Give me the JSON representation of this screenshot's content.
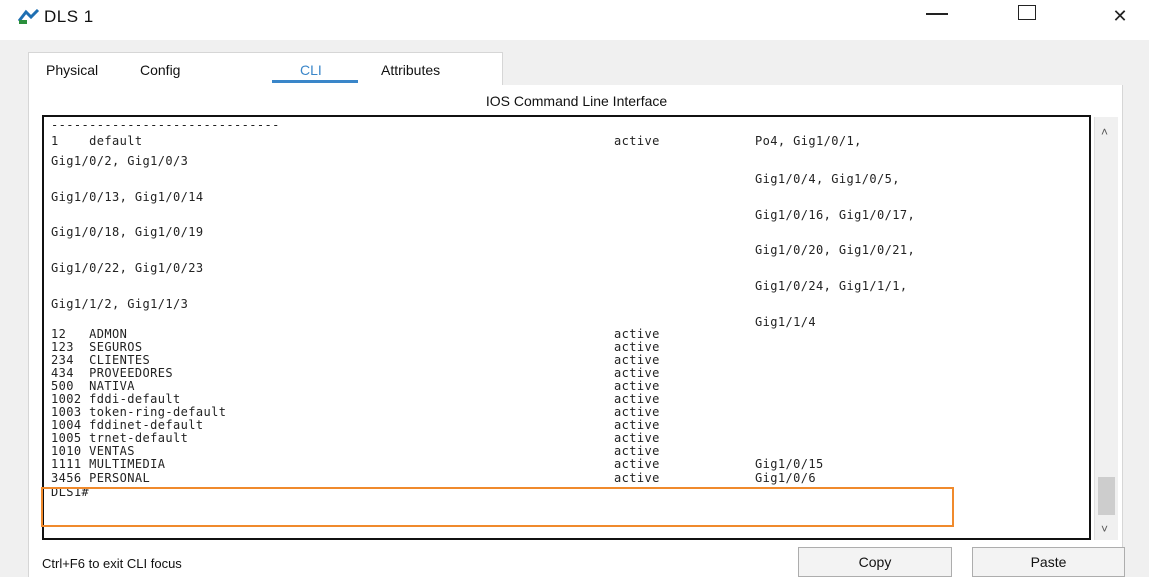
{
  "window": {
    "title": "DLS 1",
    "controls": {
      "minimize": "—",
      "maximize": "☐",
      "close": "✕"
    }
  },
  "tabs": [
    {
      "label": "Physical"
    },
    {
      "label": "Config"
    },
    {
      "label": "CLI",
      "active": true
    },
    {
      "label": "Attributes"
    }
  ],
  "panel": {
    "title": "IOS Command Line Interface"
  },
  "terminal": {
    "separator": "------------------------------",
    "lines": [
      {
        "col1": "1    default",
        "col2": "active",
        "col3": "Po4, Gig1/0/1,"
      },
      {
        "col1": "Gig1/0/2, Gig1/0/3",
        "col2": "",
        "col3": ""
      },
      {
        "col1": "",
        "col2": "",
        "col3": "Gig1/0/4, Gig1/0/5,"
      },
      {
        "col1": "Gig1/0/13, Gig1/0/14",
        "col2": "",
        "col3": ""
      },
      {
        "col1": "",
        "col2": "",
        "col3": "Gig1/0/16, Gig1/0/17,"
      },
      {
        "col1": "Gig1/0/18, Gig1/0/19",
        "col2": "",
        "col3": ""
      },
      {
        "col1": "",
        "col2": "",
        "col3": "Gig1/0/20, Gig1/0/21,"
      },
      {
        "col1": "Gig1/0/22, Gig1/0/23",
        "col2": "",
        "col3": ""
      },
      {
        "col1": "",
        "col2": "",
        "col3": "Gig1/0/24, Gig1/1/1,"
      },
      {
        "col1": "Gig1/1/2, Gig1/1/3",
        "col2": "",
        "col3": ""
      },
      {
        "col1": "",
        "col2": "",
        "col3": "Gig1/1/4"
      }
    ],
    "vlans": [
      {
        "col1": "12   ADMON",
        "col2": "active",
        "col3": ""
      },
      {
        "col1": "123  SEGUROS",
        "col2": "active",
        "col3": ""
      },
      {
        "col1": "234  CLIENTES",
        "col2": "active",
        "col3": ""
      },
      {
        "col1": "434  PROVEEDORES",
        "col2": "active",
        "col3": ""
      },
      {
        "col1": "500  NATIVA",
        "col2": "active",
        "col3": ""
      },
      {
        "col1": "1002 fddi-default",
        "col2": "active",
        "col3": ""
      },
      {
        "col1": "1003 token-ring-default",
        "col2": "active",
        "col3": ""
      },
      {
        "col1": "1004 fddinet-default",
        "col2": "active",
        "col3": ""
      },
      {
        "col1": "1005 trnet-default",
        "col2": "active",
        "col3": ""
      },
      {
        "col1": "1010 VENTAS",
        "col2": "active",
        "col3": ""
      },
      {
        "col1": "1111 MULTIMEDIA",
        "col2": "active",
        "col3": "Gig1/0/15"
      },
      {
        "col1": "3456 PERSONAL",
        "col2": "active",
        "col3": "Gig1/0/6"
      }
    ],
    "prompt": "DLS1#"
  },
  "footer": {
    "hint": "Ctrl+F6 to exit CLI focus",
    "copy_label": "Copy",
    "paste_label": "Paste"
  },
  "colors": {
    "accent": "#3a86c9",
    "highlight": "#f08a2c"
  },
  "icons": [
    "app-icon",
    "minimize-icon",
    "maximize-icon",
    "close-icon",
    "scroll-up-icon",
    "scroll-down-icon"
  ]
}
